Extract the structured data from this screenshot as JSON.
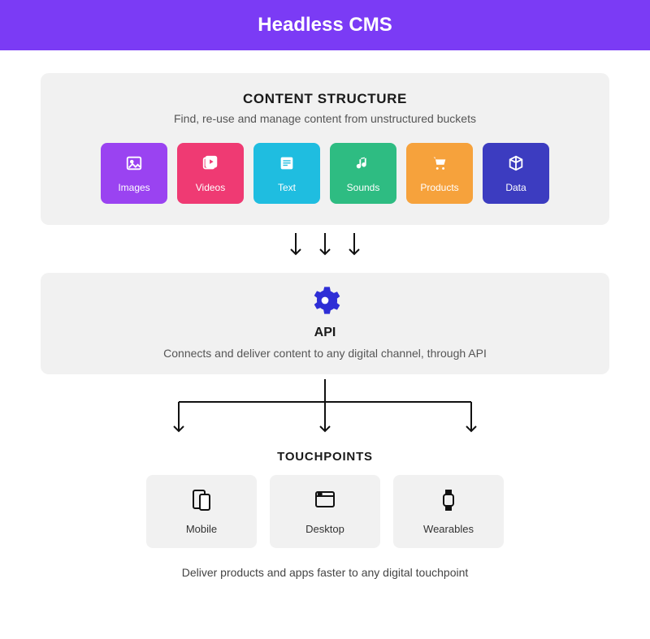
{
  "header": {
    "title": "Headless CMS"
  },
  "content": {
    "title": "CONTENT STRUCTURE",
    "subtitle": "Find, re-use  and manage content from unstructured buckets",
    "tiles": [
      {
        "label": "Images",
        "color": "t-purple"
      },
      {
        "label": "Videos",
        "color": "t-pink"
      },
      {
        "label": "Text",
        "color": "t-cyan"
      },
      {
        "label": "Sounds",
        "color": "t-green"
      },
      {
        "label": "Products",
        "color": "t-orange"
      },
      {
        "label": "Data",
        "color": "t-indigo"
      }
    ]
  },
  "api": {
    "title": "API",
    "subtitle": "Connects and deliver content to any digital channel, through API"
  },
  "touchpoints": {
    "title": "TOUCHPOINTS",
    "items": [
      {
        "label": "Mobile"
      },
      {
        "label": "Desktop"
      },
      {
        "label": "Wearables"
      }
    ],
    "subtitle": "Deliver products and apps faster to any digital touchpoint"
  },
  "colors": {
    "header_bg": "#7b3bf5",
    "panel_bg": "#f1f1f1",
    "gear": "#2e2ed6"
  }
}
